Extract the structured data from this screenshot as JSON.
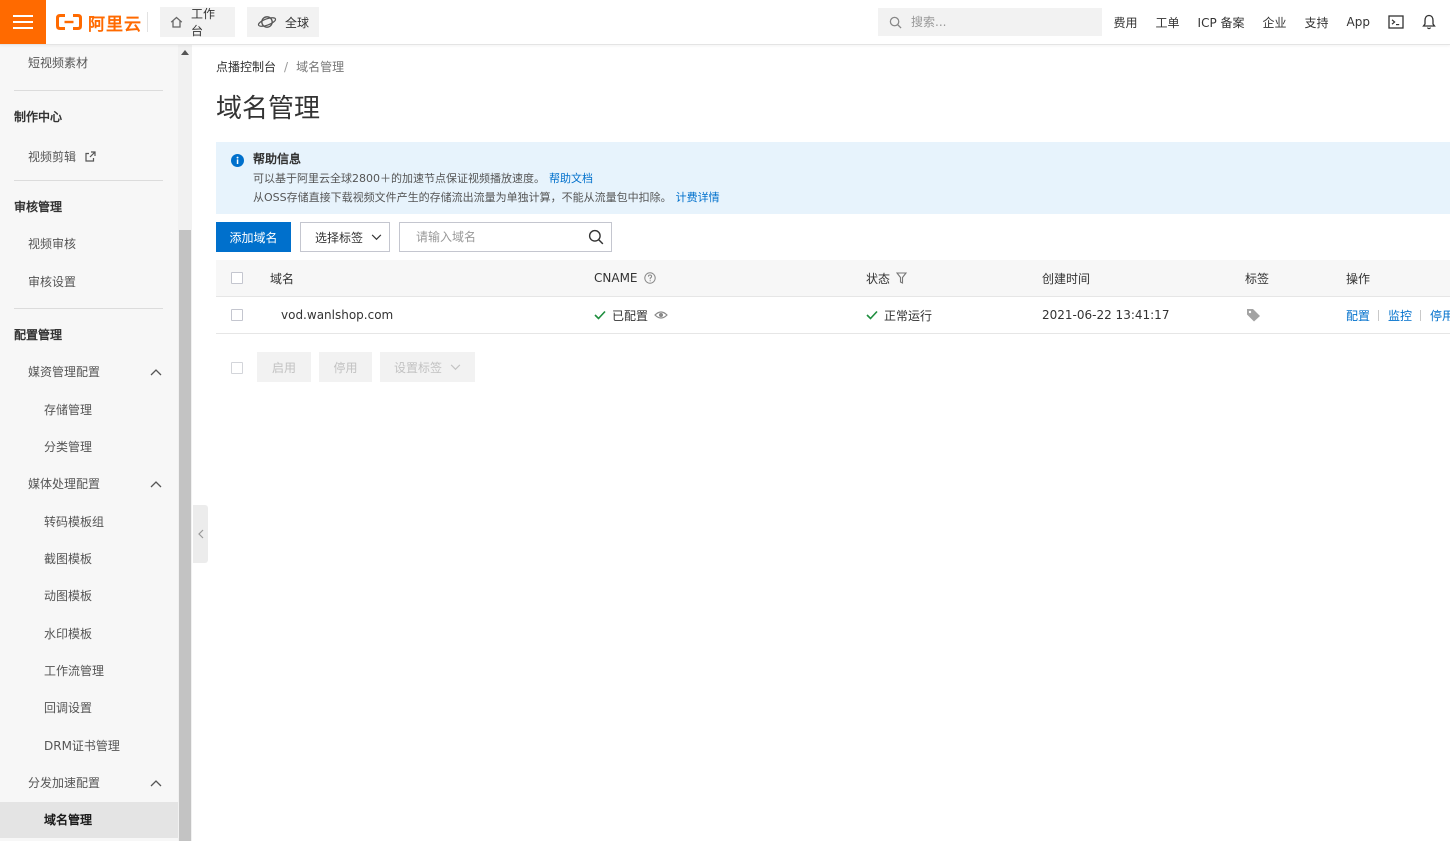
{
  "colors": {
    "brand_orange": "#ff6a00",
    "primary_blue": "#0070cc",
    "link_blue": "#0070cc",
    "success_green": "#1e8e3e",
    "help_background": "#e7f3fc",
    "active_nav_background": "#e4e4e4"
  },
  "topbar": {
    "menu_icon": "hamburger-icon",
    "logo_icon": "alibaba-cloud-logo",
    "logo_text": "阿里云",
    "workbench": {
      "label": "工作台",
      "icon": "home-icon"
    },
    "region": {
      "label": "全球",
      "icon": "globe-icon"
    },
    "search": {
      "placeholder": "搜索...",
      "icon": "search-icon"
    },
    "nav": [
      {
        "label": "费用"
      },
      {
        "label": "工单"
      },
      {
        "label": "ICP 备案"
      },
      {
        "label": "企业"
      },
      {
        "label": "支持"
      },
      {
        "label": "App"
      }
    ],
    "icons": [
      "terminal-icon",
      "bell-icon"
    ]
  },
  "sidebar": {
    "top_item": "短视频素材",
    "sections": [
      {
        "title": "制作中心",
        "items": [
          {
            "label": "视频剪辑",
            "icon": "external-link-icon"
          }
        ]
      },
      {
        "title": "审核管理",
        "items": [
          {
            "label": "视频审核"
          },
          {
            "label": "审核设置"
          }
        ]
      },
      {
        "title": "配置管理",
        "groups": [
          {
            "title": "媒资管理配置",
            "expanded": true,
            "items": [
              {
                "label": "存储管理"
              },
              {
                "label": "分类管理"
              }
            ]
          },
          {
            "title": "媒体处理配置",
            "expanded": true,
            "items": [
              {
                "label": "转码模板组"
              },
              {
                "label": "截图模板"
              },
              {
                "label": "动图模板"
              },
              {
                "label": "水印模板"
              },
              {
                "label": "工作流管理"
              },
              {
                "label": "回调设置"
              },
              {
                "label": "DRM证书管理"
              }
            ]
          },
          {
            "title": "分发加速配置",
            "expanded": true,
            "items": [
              {
                "label": "域名管理",
                "active": true
              }
            ]
          }
        ]
      }
    ]
  },
  "main": {
    "breadcrumb": {
      "items": [
        "点播控制台",
        "域名管理"
      ],
      "separator": "/"
    },
    "page_title": "域名管理",
    "help": {
      "icon": "info-icon",
      "title": "帮助信息",
      "lines": [
        {
          "text": "可以基于阿里云全球2800＋的加速节点保证视频播放速度。",
          "link": "帮助文档"
        },
        {
          "text": "从OSS存储直接下载视频文件产生的存储流出流量为单独计算，不能从流量包中扣除。",
          "link": "计费详情"
        }
      ]
    },
    "toolbar": {
      "add_button": "添加域名",
      "tag_select": "选择标签",
      "search_placeholder": "请输入域名"
    },
    "table": {
      "columns": [
        "域名",
        "CNAME",
        "状态",
        "创建时间",
        "标签",
        "操作"
      ],
      "rows": [
        {
          "domain": "vod.wanlshop.com",
          "cname": "已配置",
          "status": "正常运行",
          "created_at": "2021-06-22 13:41:17",
          "tag_icon": "tag-icon",
          "actions": [
            "配置",
            "监控",
            "停用"
          ]
        }
      ]
    },
    "bulk_actions": {
      "enable": "启用",
      "disable": "停用",
      "set_tags": "设置标签",
      "disabled": true
    }
  }
}
